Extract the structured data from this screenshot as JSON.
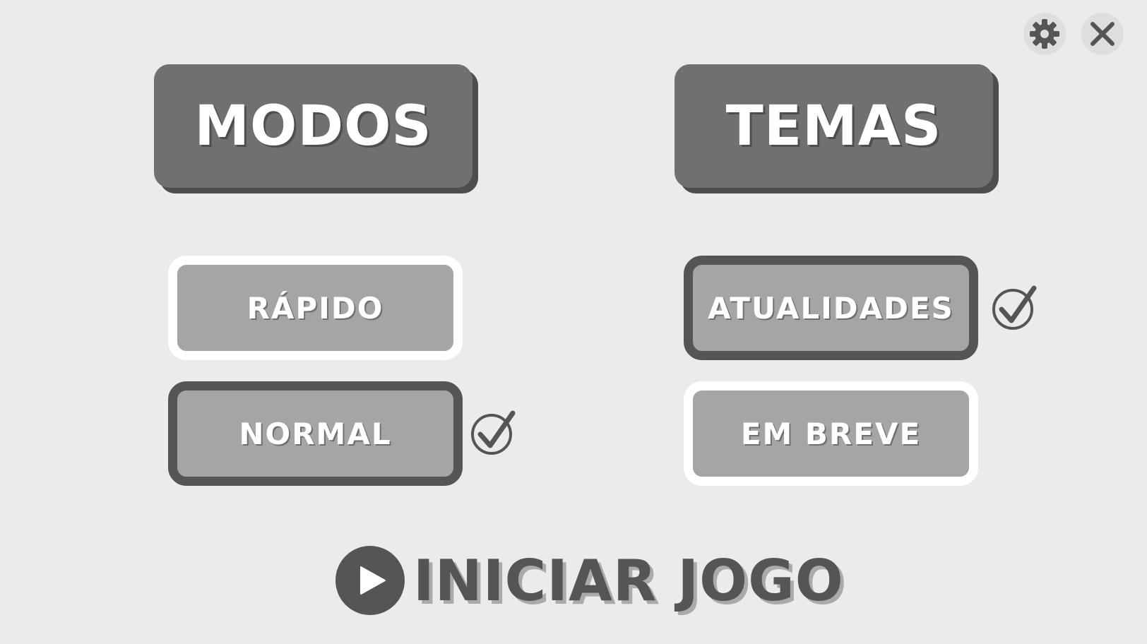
{
  "toolbar": {
    "settings_icon": "gear-icon",
    "close_icon": "close-icon"
  },
  "headers": {
    "modes_label": "MODOS",
    "themes_label": "TEMAS"
  },
  "modes": {
    "items": [
      {
        "label": "RÁPIDO",
        "selected": false
      },
      {
        "label": "NORMAL",
        "selected": true
      }
    ]
  },
  "themes": {
    "items": [
      {
        "label": "ATUALIDADES",
        "selected": true
      },
      {
        "label": "EM BREVE",
        "selected": false
      }
    ]
  },
  "start": {
    "label": "INICIAR JOGO",
    "icon": "play-icon"
  },
  "colors": {
    "background": "#ebebeb",
    "header_button": "#6f7072",
    "option_fill": "#a5a5a5",
    "selected_border": "#555557",
    "unselected_border": "#ffffff",
    "accent_dark": "#555557"
  }
}
